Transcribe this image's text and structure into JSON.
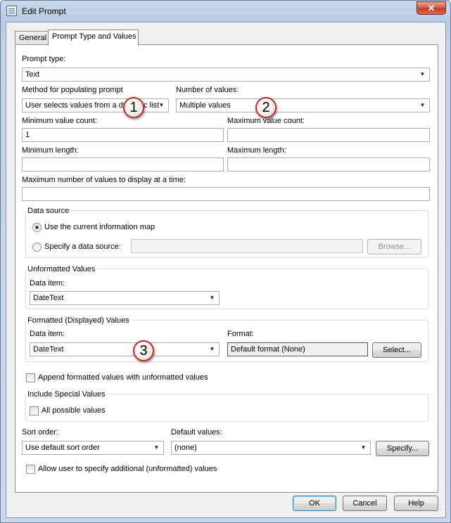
{
  "window": {
    "title": "Edit Prompt",
    "close_glyph": "✕"
  },
  "tabs": [
    {
      "label": "General",
      "active": false
    },
    {
      "label": "Prompt Type and Values",
      "active": true
    }
  ],
  "prompt_type": {
    "label": "Prompt type:",
    "value": "Text"
  },
  "method": {
    "label": "Method for populating prompt",
    "value": "User selects values from a dynamic list"
  },
  "num_values": {
    "label": "Number of values:",
    "value": "Multiple values"
  },
  "min_value_count": {
    "label": "Minimum value count:",
    "value": "1"
  },
  "max_value_count": {
    "label": "Maximum value count:",
    "value": ""
  },
  "min_length": {
    "label": "Minimum length:",
    "value": ""
  },
  "max_length": {
    "label": "Maximum length:",
    "value": ""
  },
  "max_display": {
    "label": "Maximum number of values to display at a time:",
    "value": ""
  },
  "data_source": {
    "label": "Data source",
    "option_current": "Use the current information map",
    "option_specify": "Specify a data source:",
    "selected": "current",
    "browse": "Browse..."
  },
  "unformatted": {
    "label": "Unformatted Values",
    "data_item_label": "Data item:",
    "data_item_value": "DateText"
  },
  "formatted": {
    "label": "Formatted (Displayed) Values",
    "data_item_label": "Data item:",
    "data_item_value": "DateText",
    "format_label": "Format:",
    "format_value": "Default format (None)",
    "select": "Select..."
  },
  "append_formatted": {
    "label": "Append formatted values with unformatted values",
    "checked": false
  },
  "special_values": {
    "label": "Include Special Values",
    "all_possible": {
      "label": "All possible values",
      "checked": false
    }
  },
  "sort_order": {
    "label": "Sort order:",
    "value": "Use default sort order"
  },
  "default_values": {
    "label": "Default values:",
    "value": "(none)",
    "specify": "Specify..."
  },
  "allow_additional": {
    "label": "Allow user to specify additional (unformatted) values",
    "checked": false
  },
  "footer": {
    "ok": "OK",
    "cancel": "Cancel",
    "help": "Help"
  },
  "callouts": [
    "1",
    "2",
    "3"
  ],
  "colors": {
    "callout_border": "#c62b21",
    "title_bar": "#c3d3e8",
    "close_button": "#c13c22"
  }
}
